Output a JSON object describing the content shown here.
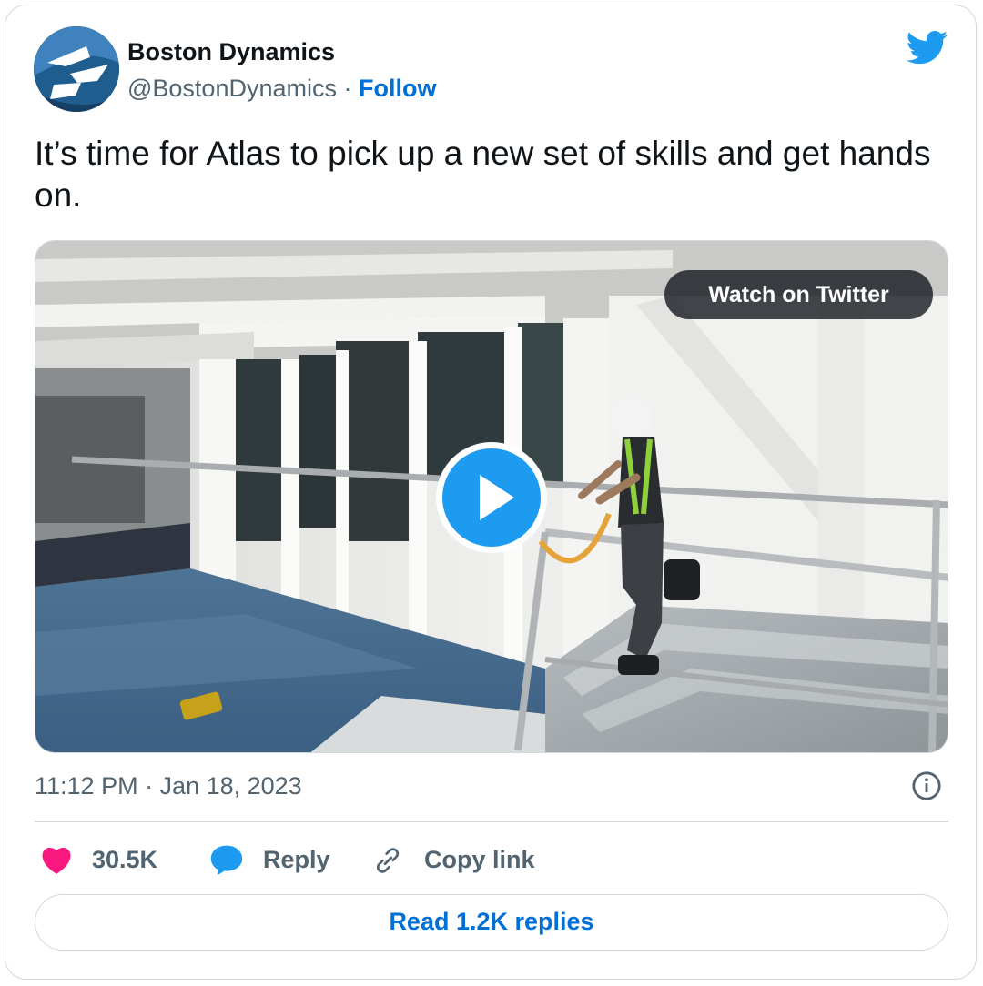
{
  "author": {
    "name": "Boston Dynamics",
    "handle": "@BostonDynamics",
    "separator": " · ",
    "follow_label": "Follow"
  },
  "tweet": {
    "text": "It’s time for Atlas to pick up a new set of skills and get hands on."
  },
  "media": {
    "watch_label": "Watch on Twitter"
  },
  "meta": {
    "timestamp": "11:12 PM · Jan 18, 2023"
  },
  "actions": {
    "likes_count": "30.5K",
    "reply_label": "Reply",
    "copy_link_label": "Copy link"
  },
  "footer": {
    "read_replies_label": "Read 1.2K replies"
  },
  "colors": {
    "twitter_blue": "#1d9bf0",
    "link_blue": "#006fd6",
    "like_pink": "#f91880",
    "secondary_text": "#536471",
    "border": "#cfd9de"
  },
  "icons": {
    "brand": "twitter-bird-icon",
    "like": "heart-icon",
    "reply": "speech-bubble-icon",
    "copy": "link-icon",
    "info": "info-icon",
    "play": "play-icon"
  }
}
